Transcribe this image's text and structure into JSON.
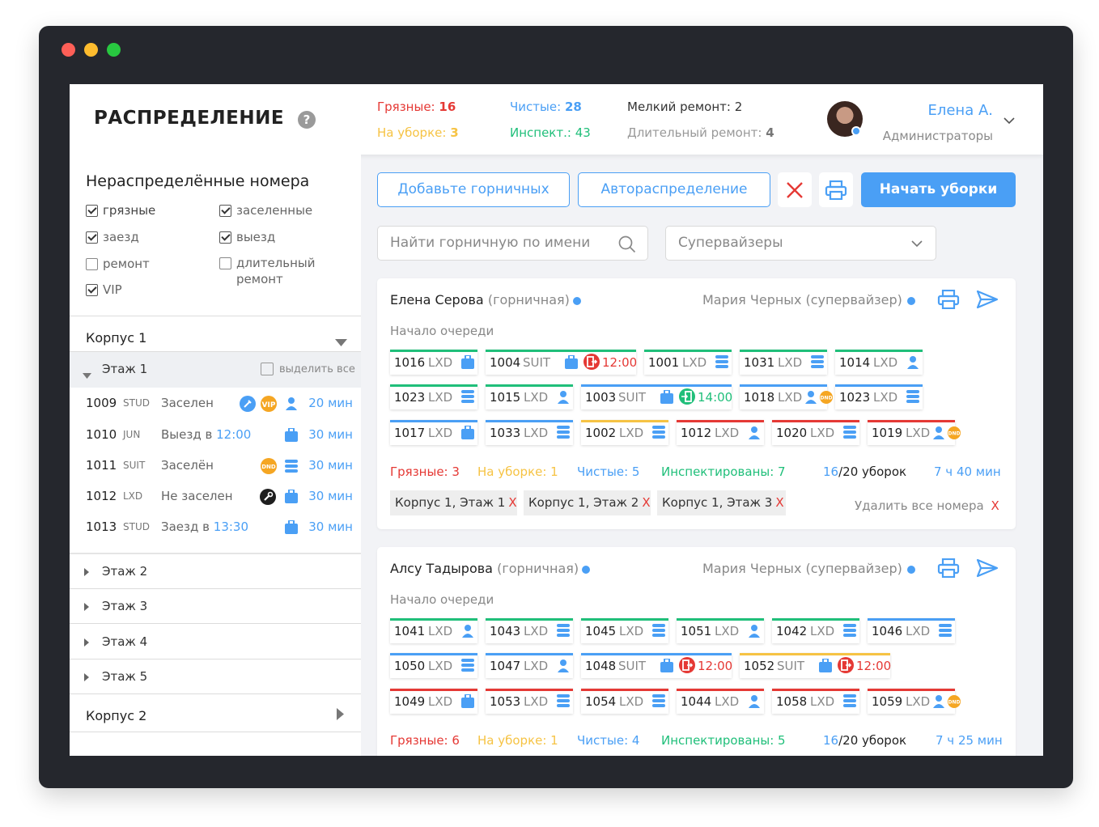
{
  "header": {
    "title": "РАСПРЕДЕЛЕНИЕ",
    "help_glyph": "?",
    "stats": {
      "dirty_label": "Грязные:",
      "dirty_value": "16",
      "clean_label": "Чистые:",
      "clean_value": "28",
      "minor_repair_label": "Мелкий ремонт:",
      "minor_repair_value": "2",
      "cleaning_label": "На уборке:",
      "cleaning_value": "3",
      "inspected_label": "Инспект.:",
      "inspected_value": "43",
      "long_repair_label": "Длительный ремонт:",
      "long_repair_value": "4"
    },
    "user": {
      "name": "Елена А.",
      "role": "Администраторы"
    }
  },
  "sidebar": {
    "title": "Нераспределённые номера",
    "filters": [
      {
        "label": "грязные",
        "checked": true
      },
      {
        "label": "заселенные",
        "checked": true
      },
      {
        "label": "заезд",
        "checked": true
      },
      {
        "label": "выезд",
        "checked": true
      },
      {
        "label": "ремонт",
        "checked": false
      },
      {
        "label": "длительный",
        "label2": "ремонт",
        "checked": false
      },
      {
        "label": "VIP",
        "checked": true
      }
    ],
    "corpus1": "Корпус 1",
    "floor1": "Этаж 1",
    "select_all": "выделить все",
    "rooms": [
      {
        "num": "1009",
        "type": "STUD",
        "status": "Заселен",
        "time": "",
        "minutes": "20 мин"
      },
      {
        "num": "1010",
        "type": "JUN",
        "status": "Выезд в",
        "time": "12:00",
        "minutes": "30 мин"
      },
      {
        "num": "1011",
        "type": "SUIT",
        "status": "Заселён",
        "time": "",
        "minutes": "30 мин"
      },
      {
        "num": "1012",
        "type": "LXD",
        "status": "Не заселен",
        "time": "",
        "minutes": "30 мин"
      },
      {
        "num": "1013",
        "type": "STUD",
        "status": "Заезд в",
        "time": "13:30",
        "minutes": "30 мин"
      }
    ],
    "floors": [
      "Этаж 2",
      "Этаж 3",
      "Этаж 4",
      "Этаж 5"
    ],
    "corpus2": "Корпус 2"
  },
  "toolbar": {
    "add_maids": "Добавьте горничных",
    "auto_assign": "Автораспределение",
    "start_cleaning": "Начать уборки",
    "search_placeholder": "Найти горничную по имени",
    "supervisors": "Супервайзеры"
  },
  "icons": {
    "help": "help-icon",
    "close": "close-icon",
    "print": "print-icon",
    "send": "send-icon",
    "search": "search-icon",
    "chevron": "chevron-down-icon",
    "luggage": "luggage-icon",
    "stack": "linen-icon",
    "person": "person-icon",
    "dnd": "dnd-icon",
    "vip": "vip-icon",
    "checkout": "checkout-icon",
    "checkin": "checkin-icon",
    "wrench": "wrench-icon",
    "broom": "broom-icon"
  },
  "colors": {
    "accent": "#4a9ff5",
    "dirty": "#e53935",
    "cleaning": "#f6c344",
    "clean": "#4a9ff5",
    "inspected": "#20bf7a",
    "orange": "#f5a623",
    "muted": "#888888"
  },
  "cards": [
    {
      "maid_name": "Елена Серова",
      "maid_role": "(горничная)",
      "supervisor": "Мария Черных (супервайзер)",
      "queue_label": "Начало очереди",
      "rows": [
        [
          {
            "num": "1016",
            "type": "LXD",
            "bar": "#20bf7a",
            "icon": "luggage"
          },
          {
            "num": "1004",
            "type": "SUIT",
            "bar": "#20bf7a",
            "icon": "luggage",
            "badge": "checkout",
            "time": "12:00"
          },
          {
            "num": "1001",
            "type": "LXD",
            "bar": "#20bf7a",
            "icon": "stack"
          },
          {
            "num": "1031",
            "type": "LXD",
            "bar": "#20bf7a",
            "icon": "stack"
          },
          {
            "num": "1014",
            "type": "LXD",
            "bar": "#20bf7a",
            "icon": "person"
          }
        ],
        [
          {
            "num": "1023",
            "type": "LXD",
            "bar": "#20bf7a",
            "icon": "stack"
          },
          {
            "num": "1015",
            "type": "LXD",
            "bar": "#20bf7a",
            "icon": "person"
          },
          {
            "num": "1003",
            "type": "SUIT",
            "bar": "#4a9ff5",
            "icon": "luggage",
            "badge": "checkin",
            "time": "14:00"
          },
          {
            "num": "1018",
            "type": "LXD",
            "bar": "#4a9ff5",
            "icon": "person",
            "badge": "dnd"
          },
          {
            "num": "1023",
            "type": "LXD",
            "bar": "#4a9ff5",
            "icon": "stack"
          }
        ],
        [
          {
            "num": "1017",
            "type": "LXD",
            "bar": "#4a9ff5",
            "icon": "luggage"
          },
          {
            "num": "1033",
            "type": "LXD",
            "bar": "#4a9ff5",
            "icon": "stack"
          },
          {
            "num": "1002",
            "type": "LXD",
            "bar": "#f6c344",
            "icon": "stack"
          },
          {
            "num": "1012",
            "type": "LXD",
            "bar": "#e53935",
            "icon": "person"
          },
          {
            "num": "1020",
            "type": "LXD",
            "bar": "#e53935",
            "icon": "stack"
          },
          {
            "num": "1019",
            "type": "LXD",
            "bar": "#e53935",
            "icon": "person",
            "badge": "dnd"
          }
        ]
      ],
      "summary": {
        "dirty": "Грязные: 3",
        "cleaning": "На уборке: 1",
        "clean": "Чистые: 5",
        "inspected": "Инспектированы: 7",
        "done": "16",
        "total": "/20 уборок",
        "duration": "7 ч 40 мин"
      },
      "tags": [
        "Корпус 1, Этаж 1",
        "Корпус 1, Этаж 2",
        "Корпус 1, Этаж 3"
      ],
      "tag_x": "X",
      "remove_all": "Удалить все номера",
      "remove_x": "X"
    },
    {
      "maid_name": "Алсу Тадырова",
      "maid_role": "(горничная)",
      "supervisor": "Мария Черных (супервайзер)",
      "queue_label": "Начало очереди",
      "rows": [
        [
          {
            "num": "1041",
            "type": "LXD",
            "bar": "#20bf7a",
            "icon": "person"
          },
          {
            "num": "1043",
            "type": "LXD",
            "bar": "#20bf7a",
            "icon": "stack"
          },
          {
            "num": "1045",
            "type": "LXD",
            "bar": "#20bf7a",
            "icon": "stack"
          },
          {
            "num": "1051",
            "type": "LXD",
            "bar": "#20bf7a",
            "icon": "person"
          },
          {
            "num": "1042",
            "type": "LXD",
            "bar": "#20bf7a",
            "icon": "stack"
          },
          {
            "num": "1046",
            "type": "LXD",
            "bar": "#4a9ff5",
            "icon": "stack"
          }
        ],
        [
          {
            "num": "1050",
            "type": "LXD",
            "bar": "#4a9ff5",
            "icon": "stack"
          },
          {
            "num": "1047",
            "type": "LXD",
            "bar": "#4a9ff5",
            "icon": "person"
          },
          {
            "num": "1048",
            "type": "SUIT",
            "bar": "#4a9ff5",
            "icon": "luggage",
            "badge": "checkout",
            "time": "12:00"
          },
          {
            "num": "1052",
            "type": "SUIT",
            "bar": "#f6c344",
            "icon": "luggage",
            "badge": "checkout",
            "time": "12:00"
          }
        ],
        [
          {
            "num": "1049",
            "type": "LXD",
            "bar": "#e53935",
            "icon": "luggage"
          },
          {
            "num": "1053",
            "type": "LXD",
            "bar": "#e53935",
            "icon": "stack"
          },
          {
            "num": "1054",
            "type": "LXD",
            "bar": "#e53935",
            "icon": "stack"
          },
          {
            "num": "1044",
            "type": "LXD",
            "bar": "#e53935",
            "icon": "person"
          },
          {
            "num": "1058",
            "type": "LXD",
            "bar": "#e53935",
            "icon": "stack"
          },
          {
            "num": "1059",
            "type": "LXD",
            "bar": "#e53935",
            "icon": "person",
            "badge": "dnd"
          }
        ]
      ],
      "summary": {
        "dirty": "Грязные: 6",
        "cleaning": "На уборке: 1",
        "clean": "Чистые: 4",
        "inspected": "Инспектированы: 5",
        "done": "16",
        "total": "/20 уборок",
        "duration": "7 ч 25 мин"
      }
    }
  ]
}
